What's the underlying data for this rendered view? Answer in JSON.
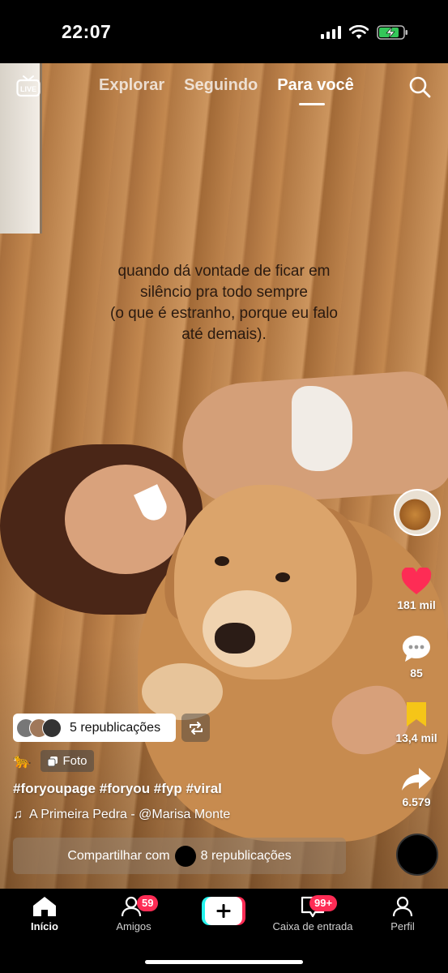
{
  "status": {
    "time": "22:07"
  },
  "top_nav": {
    "live_label": "LIVE",
    "tabs": [
      {
        "label": "Explorar"
      },
      {
        "label": "Seguindo"
      },
      {
        "label": "Para você",
        "active": true
      }
    ]
  },
  "post": {
    "overlay_lines": [
      "quando dá vontade de ficar em",
      "silêncio pra todo sempre",
      "(o que é estranho, porque eu falo",
      "até demais)."
    ],
    "likes": "181 mil",
    "comments": "85",
    "saves": "13,4 mil",
    "shares": "6.579",
    "republish_label": "5 republicações",
    "photo_label": "Foto",
    "hashtags": "#foryoupage #foryou #fyp #viral",
    "music": "A Primeira Pedra - @Marisa Monte",
    "share_bar": {
      "prefix": "Compartilhar com",
      "suffix": "8 republicações"
    }
  },
  "tab_bar": {
    "items": [
      {
        "label": "Início",
        "active": true
      },
      {
        "label": "Amigos",
        "badge": "59"
      },
      {
        "label": ""
      },
      {
        "label": "Caixa de entrada",
        "badge": "99+"
      },
      {
        "label": "Perfil"
      }
    ]
  },
  "colors": {
    "like": "#fe2c55",
    "save": "#f5c518",
    "badge": "#fe2c55"
  }
}
